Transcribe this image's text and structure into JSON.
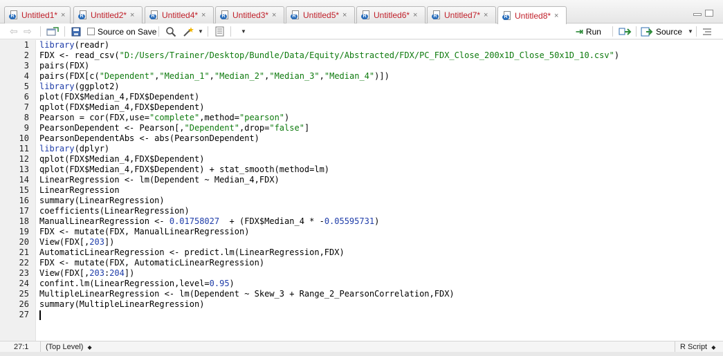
{
  "tabs": [
    {
      "label": "Untitled1*",
      "close": "×"
    },
    {
      "label": "Untitled2*",
      "close": "×"
    },
    {
      "label": "Untitled4*",
      "close": "×"
    },
    {
      "label": "Untitled3*",
      "close": "×"
    },
    {
      "label": "Untitled5*",
      "close": "×"
    },
    {
      "label": "Untitled6*",
      "close": "×"
    },
    {
      "label": "Untitled7*",
      "close": "×"
    },
    {
      "label": "Untitled8*",
      "close": "×",
      "active": true
    }
  ],
  "toolbar": {
    "source_on_save": "Source on Save",
    "run": "Run",
    "source": "Source"
  },
  "editor": {
    "line_numbers": [
      "1",
      "2",
      "3",
      "4",
      "5",
      "6",
      "7",
      "8",
      "9",
      "10",
      "11",
      "12",
      "13",
      "14",
      "15",
      "16",
      "17",
      "18",
      "19",
      "20",
      "21",
      "22",
      "23",
      "24",
      "25",
      "26",
      "27"
    ],
    "lines": [
      [
        {
          "t": "library",
          "c": "kw"
        },
        {
          "t": "(readr)"
        }
      ],
      [
        {
          "t": "FDX <- read_csv("
        },
        {
          "t": "\"D:/Users/Trainer/Desktop/Bundle/Data/Equity/Abstracted/FDX/PC_FDX_Close_200x1D_Close_50x1D_10.csv\"",
          "c": "str"
        },
        {
          "t": ")"
        }
      ],
      [
        {
          "t": "pairs(FDX)"
        }
      ],
      [
        {
          "t": "pairs(FDX[c("
        },
        {
          "t": "\"Dependent\"",
          "c": "str"
        },
        {
          "t": ","
        },
        {
          "t": "\"Median_1\"",
          "c": "str"
        },
        {
          "t": ","
        },
        {
          "t": "\"Median_2\"",
          "c": "str"
        },
        {
          "t": ","
        },
        {
          "t": "\"Median_3\"",
          "c": "str"
        },
        {
          "t": ","
        },
        {
          "t": "\"Median_4\"",
          "c": "str"
        },
        {
          "t": ")])"
        }
      ],
      [
        {
          "t": "library",
          "c": "kw"
        },
        {
          "t": "(ggplot2)"
        }
      ],
      [
        {
          "t": "plot(FDX$Median_4,FDX$Dependent)"
        }
      ],
      [
        {
          "t": "qplot(FDX$Median_4,FDX$Dependent)"
        }
      ],
      [
        {
          "t": "Pearson = cor(FDX,use="
        },
        {
          "t": "\"complete\"",
          "c": "str"
        },
        {
          "t": ",method="
        },
        {
          "t": "\"pearson\"",
          "c": "str"
        },
        {
          "t": ")"
        }
      ],
      [
        {
          "t": "PearsonDependent <- Pearson[,"
        },
        {
          "t": "\"Dependent\"",
          "c": "str"
        },
        {
          "t": ",drop="
        },
        {
          "t": "\"false\"",
          "c": "str"
        },
        {
          "t": "]"
        }
      ],
      [
        {
          "t": "PearsonDependentAbs <- abs(PearsonDependent)"
        }
      ],
      [
        {
          "t": "library",
          "c": "kw"
        },
        {
          "t": "(dplyr)"
        }
      ],
      [
        {
          "t": "qplot(FDX$Median_4,FDX$Dependent)"
        }
      ],
      [
        {
          "t": "qplot(FDX$Median_4,FDX$Dependent) + stat_smooth(method=lm)"
        }
      ],
      [
        {
          "t": "LinearRegression <- lm(Dependent ~ Median_4,FDX)"
        }
      ],
      [
        {
          "t": "LinearRegression"
        }
      ],
      [
        {
          "t": "summary(LinearRegression)"
        }
      ],
      [
        {
          "t": "coefficients(LinearRegression)"
        }
      ],
      [
        {
          "t": "ManualLinearRegression <- "
        },
        {
          "t": "0.01758027",
          "c": "num"
        },
        {
          "t": "  + (FDX$Median_4 * -"
        },
        {
          "t": "0.05595731",
          "c": "num"
        },
        {
          "t": ")"
        }
      ],
      [
        {
          "t": "FDX <- mutate(FDX, ManualLinearRegression)"
        }
      ],
      [
        {
          "t": "View(FDX[,"
        },
        {
          "t": "203",
          "c": "num"
        },
        {
          "t": "])"
        }
      ],
      [
        {
          "t": "AutomaticLinearRegression <- predict.lm(LinearRegression,FDX)"
        }
      ],
      [
        {
          "t": "FDX <- mutate(FDX, AutomaticLinearRegression)"
        }
      ],
      [
        {
          "t": "View(FDX[,"
        },
        {
          "t": "203",
          "c": "num"
        },
        {
          "t": ":"
        },
        {
          "t": "204",
          "c": "num"
        },
        {
          "t": "])"
        }
      ],
      [
        {
          "t": "confint.lm(LinearRegression,level="
        },
        {
          "t": "0.95",
          "c": "num"
        },
        {
          "t": ")"
        }
      ],
      [
        {
          "t": "MultipleLinearRegression <- lm(Dependent ~ Skew_3 + Range_2_PearsonCorrelation,FDX)"
        }
      ],
      [
        {
          "t": "summary(MultipleLinearRegression)"
        }
      ],
      []
    ]
  },
  "status": {
    "position": "27:1",
    "scope": "(Top Level)",
    "filetype": "R Script"
  },
  "icons": {
    "tab_file": "r-script-file-icon",
    "back": "back-arrow-icon",
    "forward": "forward-arrow-icon",
    "show_in_window": "show-in-new-window-icon",
    "save": "save-icon",
    "find": "search-icon",
    "wand": "magic-wand-icon",
    "compile": "compile-report-icon",
    "run": "run-arrow-icon",
    "rerun": "rerun-icon",
    "source": "source-icon",
    "outline": "outline-icon"
  },
  "colors": {
    "keyword": "#1e3ca8",
    "string": "#0e7a0e",
    "number": "#1e3ca8",
    "tab_text": "#c0202a",
    "run_arrow": "#2e8b3a"
  }
}
